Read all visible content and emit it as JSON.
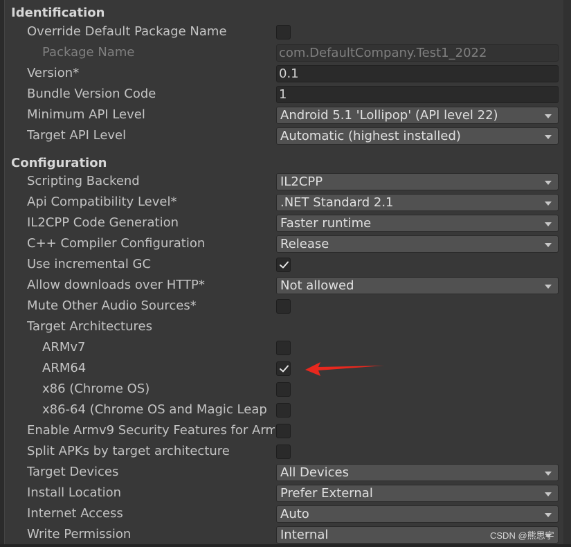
{
  "identification": {
    "header": "Identification",
    "override_default_package_name": {
      "label": "Override Default Package Name",
      "checked": false
    },
    "package_name": {
      "label": "Package Name",
      "value": "com.DefaultCompany.Test1_2022"
    },
    "version": {
      "label": "Version*",
      "value": "0.1"
    },
    "bundle_version_code": {
      "label": "Bundle Version Code",
      "value": "1"
    },
    "minimum_api_level": {
      "label": "Minimum API Level",
      "value": "Android 5.1 'Lollipop' (API level 22)"
    },
    "target_api_level": {
      "label": "Target API Level",
      "value": "Automatic (highest installed)"
    }
  },
  "configuration": {
    "header": "Configuration",
    "scripting_backend": {
      "label": "Scripting Backend",
      "value": "IL2CPP"
    },
    "api_compatibility_level": {
      "label": "Api Compatibility Level*",
      "value": ".NET Standard 2.1"
    },
    "il2cpp_code_generation": {
      "label": "IL2CPP Code Generation",
      "value": "Faster runtime"
    },
    "cpp_compiler_configuration": {
      "label": "C++ Compiler Configuration",
      "value": "Release"
    },
    "use_incremental_gc": {
      "label": "Use incremental GC",
      "checked": true
    },
    "allow_downloads_over_http": {
      "label": "Allow downloads over HTTP*",
      "value": "Not allowed"
    },
    "mute_other_audio_sources": {
      "label": "Mute Other Audio Sources*",
      "checked": false
    },
    "target_architectures": {
      "label": "Target Architectures",
      "armv7": {
        "label": "ARMv7",
        "checked": false
      },
      "arm64": {
        "label": "ARM64",
        "checked": true
      },
      "x86": {
        "label": "x86 (Chrome OS)",
        "checked": false
      },
      "x86_64": {
        "label": "x86-64 (Chrome OS and Magic Leap",
        "checked": false
      }
    },
    "enable_armv9_security": {
      "label": "Enable Armv9 Security Features for Arm",
      "checked": false
    },
    "split_apks": {
      "label": "Split APKs by target architecture",
      "checked": false
    },
    "target_devices": {
      "label": "Target Devices",
      "value": "All Devices"
    },
    "install_location": {
      "label": "Install Location",
      "value": "Prefer External"
    },
    "internet_access": {
      "label": "Internet Access",
      "value": "Auto"
    },
    "write_permission": {
      "label": "Write Permission",
      "value": "Internal"
    }
  },
  "annotation": {
    "color": "#e8281e",
    "icon": "red-arrow-pointing-left"
  },
  "watermark": "CSDN @熊思宇",
  "colors": {
    "background": "#383838",
    "field": "#2a2a2a",
    "dropdown": "#515151",
    "text": "#c4c4c4"
  }
}
